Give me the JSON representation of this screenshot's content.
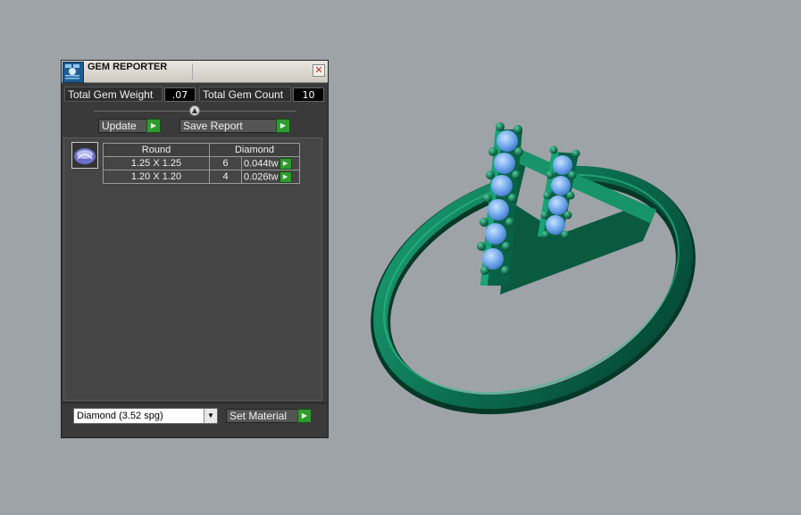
{
  "panel": {
    "title": "GEM REPORTER",
    "close_glyph": "✕",
    "total_weight_label": "Total Gem Weight",
    "total_weight_value": ".07",
    "total_count_label": "Total Gem Count",
    "total_count_value": "10",
    "update_label": "Update",
    "save_report_label": "Save Report",
    "table": {
      "headers": [
        "Round",
        "Diamond"
      ],
      "rows": [
        {
          "size": "1.25 X 1.25",
          "count": "6",
          "weight": "0.044tw"
        },
        {
          "size": "1.20 X 1.20",
          "count": "4",
          "weight": "0.026tw"
        }
      ]
    },
    "material_select_value": "Diamond     (3.52 spg)",
    "set_material_label": "Set Material"
  },
  "icons": {
    "app": "gem-reporter-icon",
    "close": "close-icon",
    "arrow": "play-arrow-icon",
    "slider": "collapse-up-icon",
    "dropdown": "chevron-down-icon"
  },
  "colors": {
    "viewport_bg": "#9ea3a8",
    "panel_bg": "#3a3a3a",
    "metal": "#0c6f4f",
    "stone": "#7fb0f0",
    "accent_button": "#2f9b2f"
  }
}
